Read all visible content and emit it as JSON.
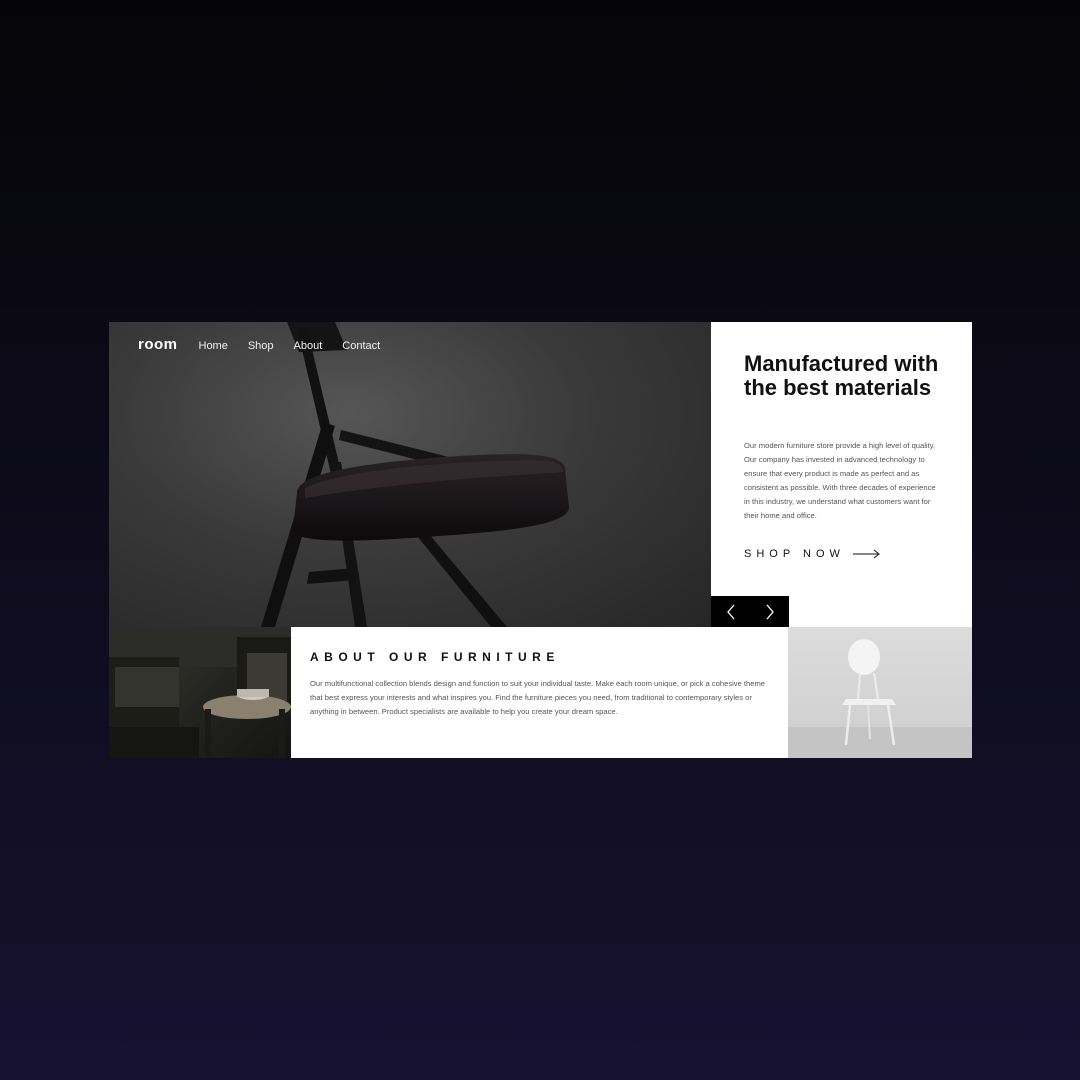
{
  "nav": {
    "logo": "room",
    "links": [
      "Home",
      "Shop",
      "About",
      "Contact"
    ]
  },
  "hero": {
    "image_icon": "folding-chair-photo"
  },
  "copy": {
    "headline": "Manufactured with the best materials",
    "body": "Our modern furniture store provide a high level of quality. Our company has invested in advanced technology to ensure that every product is made as perfect and as consistent as possible. With three decades of experience in this industry, we understand what customers want for their home and office.",
    "cta_label": "SHOP NOW",
    "cta_icon": "arrow-right-icon"
  },
  "controls": {
    "prev_icon": "chevron-left-icon",
    "next_icon": "chevron-right-icon"
  },
  "about": {
    "title": "ABOUT OUR FURNITURE",
    "body": "Our multifunctional collection blends design and function to suit your individual taste. Make each room unique, or pick a cohesive theme that best express your interests and what inspires you. Find the furniture pieces you need, from traditional to contemporary styles or anything in between. Product specialists are available to help you create your dream space."
  },
  "images": {
    "left": "dark-living-room-photo",
    "right": "white-chair-photo"
  },
  "colors": {
    "background_top": "#050508",
    "background_bottom": "#171230",
    "accent": "#000000",
    "text": "#111111",
    "muted_text": "#555555"
  }
}
